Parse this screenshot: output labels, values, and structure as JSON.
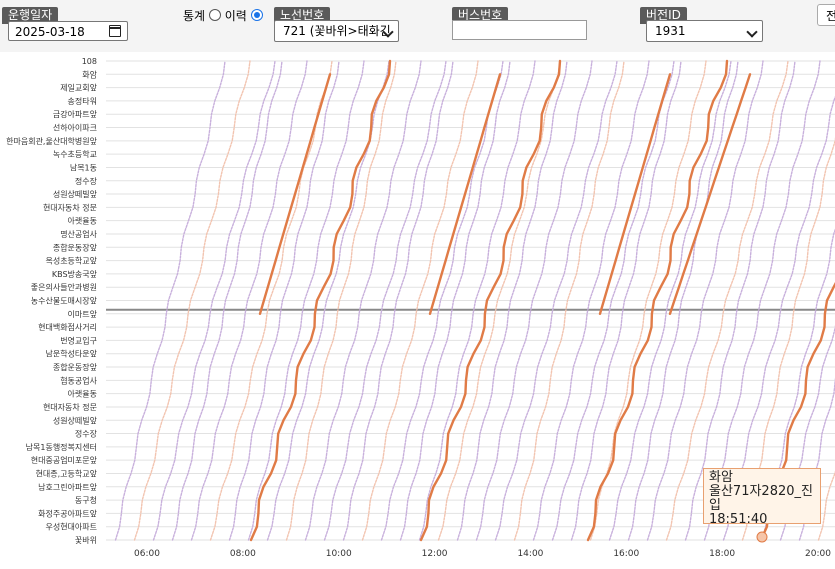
{
  "filters": {
    "date_label": "운행일자",
    "date_value": "2025-03-18",
    "stat_label": "통계",
    "history_label": "이력",
    "route_label": "노선번호",
    "route_value": "721 (꽃바위>태화긴",
    "bus_label": "버스번호",
    "bus_value": "",
    "version_label": "버전ID",
    "version_value": "1931",
    "partial_button": "전"
  },
  "chart_data": {
    "type": "line",
    "stops": [
      "108",
      "화암",
      "제일교회앞",
      "송정타워",
      "금강아파트앞",
      "선하아이파크",
      "한마음회관,울산대학병원앞",
      "녹수초등학교",
      "남목1동",
      "정수장",
      "성원상떼빌앞",
      "현대자동차 정문",
      "아랫율동",
      "명산공업사",
      "종합운동장앞",
      "옥성초등학교앞",
      "KBS방송국앞",
      "좋은의사들안과병원",
      "농수산물도매시장앞",
      "이마트앞",
      "현대백화점사거리",
      "번영교입구",
      "남운학성타운앞",
      "종합운동장앞",
      "협동공업사",
      "아랫율동",
      "현대자동차 정문",
      "성원상떼빌앞",
      "정수장",
      "남목1동행정복지센터",
      "현대중공업미포문앞",
      "현대종,고등학교앞",
      "남호그린아파트앞",
      "동구청",
      "화정주공아파트앞",
      "우성현대아파트",
      "꽃바위"
    ],
    "x_ticks": [
      "06:00",
      "08:00",
      "10:00",
      "12:00",
      "14:00",
      "16:00",
      "18:00",
      "20:00"
    ],
    "highlight_stop": "이마트앞",
    "colors": {
      "trip": "#c8b0dc",
      "trip_alt": "#f2c4b0",
      "selected": "#e07b46",
      "grid": "#e2e2e2",
      "hline": "#888888"
    },
    "tooltip": {
      "stop": "화암",
      "bus": "울산71자2820_진입",
      "time": "18:51:40"
    }
  }
}
